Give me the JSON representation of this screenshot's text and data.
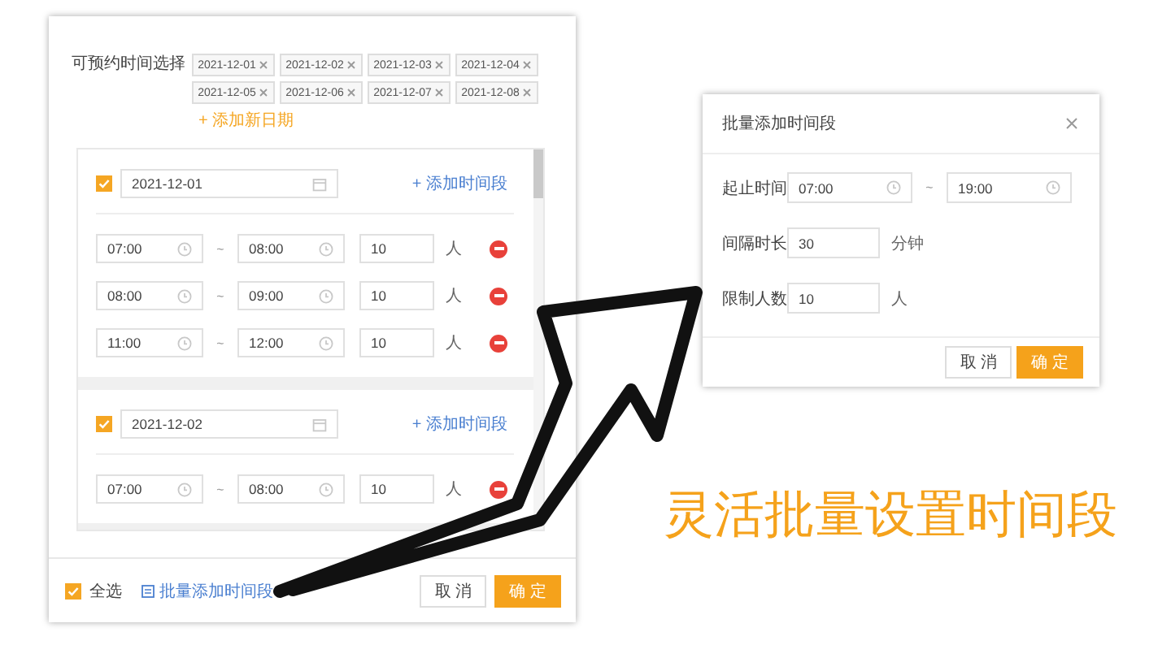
{
  "left_panel": {
    "date_label": "可预约时间选择",
    "date_tags": [
      "2021-12-01",
      "2021-12-02",
      "2021-12-03",
      "2021-12-04",
      "2021-12-05",
      "2021-12-06",
      "2021-12-07",
      "2021-12-08"
    ],
    "add_date": "+ 添加新日期",
    "range_separator": "~",
    "day_groups": [
      {
        "checked": true,
        "date": "2021-12-01",
        "add_slot": "+ 添加时间段",
        "slots": [
          {
            "start": "07:00",
            "end": "08:00",
            "count": "10",
            "unit": "人"
          },
          {
            "start": "08:00",
            "end": "09:00",
            "count": "10",
            "unit": "人"
          },
          {
            "start": "11:00",
            "end": "12:00",
            "count": "10",
            "unit": "人"
          }
        ]
      },
      {
        "checked": true,
        "date": "2021-12-02",
        "add_slot": "+ 添加时间段",
        "slots": [
          {
            "start": "07:00",
            "end": "08:00",
            "count": "10",
            "unit": "人"
          }
        ]
      }
    ],
    "footer": {
      "select_all": {
        "label": "全选",
        "checked": true
      },
      "batch_link": "批量添加时间段",
      "buttons": [
        {
          "label": "取 消",
          "kind": "default"
        },
        {
          "label": "确 定",
          "kind": "primary"
        }
      ]
    }
  },
  "batch_dialog": {
    "title": "批量添加时间段",
    "fields": [
      {
        "kind": "range",
        "label": "起止时间",
        "start": "07:00",
        "end": "19:00",
        "separator": "~"
      },
      {
        "kind": "number",
        "label": "间隔时长",
        "value": "30",
        "unit": "分钟"
      },
      {
        "kind": "number",
        "label": "限制人数",
        "value": "10",
        "unit": "人"
      }
    ],
    "buttons": [
      {
        "label": "取 消",
        "kind": "default"
      },
      {
        "label": "确 定",
        "kind": "primary"
      }
    ]
  },
  "slogan": "灵活批量设置时间段"
}
